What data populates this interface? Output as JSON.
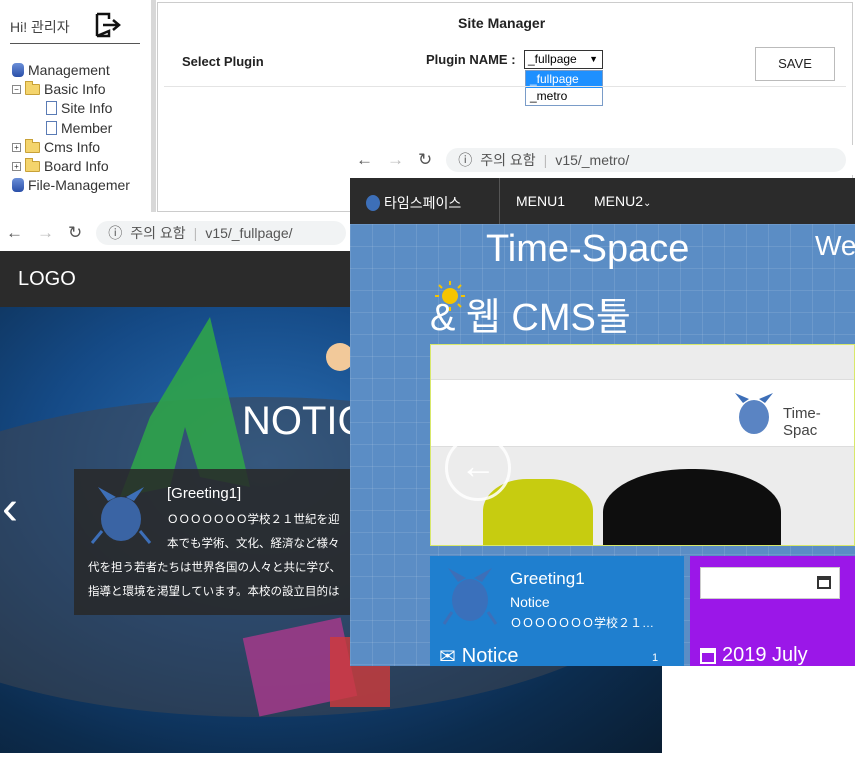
{
  "admin": {
    "greeting": "Hi! 관리자",
    "tree": {
      "management": "Management",
      "basic_info": "Basic Info",
      "site_info": "Site Info",
      "member": "Member",
      "cms_info": "Cms Info",
      "board_info": "Board Info",
      "file_management": "File-Managemer"
    }
  },
  "site_manager": {
    "title": "Site Manager",
    "select_plugin_label": "Select Plugin",
    "plugin_name_label": "Plugin NAME :",
    "selected_plugin": "_fullpage",
    "options": [
      "_fullpage",
      "_metro"
    ],
    "save_label": "SAVE"
  },
  "browser_fullpage": {
    "security_label": "주의 요함",
    "url": "v15/_fullpage/"
  },
  "browser_metro": {
    "security_label": "주의 요함",
    "url": "v15/_metro/"
  },
  "fullpage_site": {
    "logo": "LOGO",
    "hero_title": "NOTIC",
    "card_title": "[Greeting1]",
    "card_lines": [
      "ＯＯＯＯＯＯＯ学校２１世紀を迎",
      "本でも学術、文化、経済など様々",
      "代を担う若者たちは世界各国の人々と共に学び、",
      "指導と環境を渇望しています。本校の設立目的は"
    ]
  },
  "metro_site": {
    "brand": "타임스페이스",
    "menu1": "MENU1",
    "menu2": "MENU2",
    "title_line1": "Time-Space",
    "title_line2": "& 웹 CMS툴",
    "we_text": "We",
    "slide_brand": "Time-Spac",
    "tile1": {
      "title": "Greeting1",
      "subtitle": "Notice",
      "text": "ＯＯＯＯＯＯＯ学校２１…",
      "notice_label": "Notice",
      "count": "1"
    },
    "tile2": {
      "title": "2019 July"
    }
  },
  "colors": {
    "metro_blue": "#5b8dc5",
    "tile_blue": "#1f7fcf",
    "tile_purple": "#9b17e8",
    "dropdown_highlight": "#1e90ff"
  }
}
